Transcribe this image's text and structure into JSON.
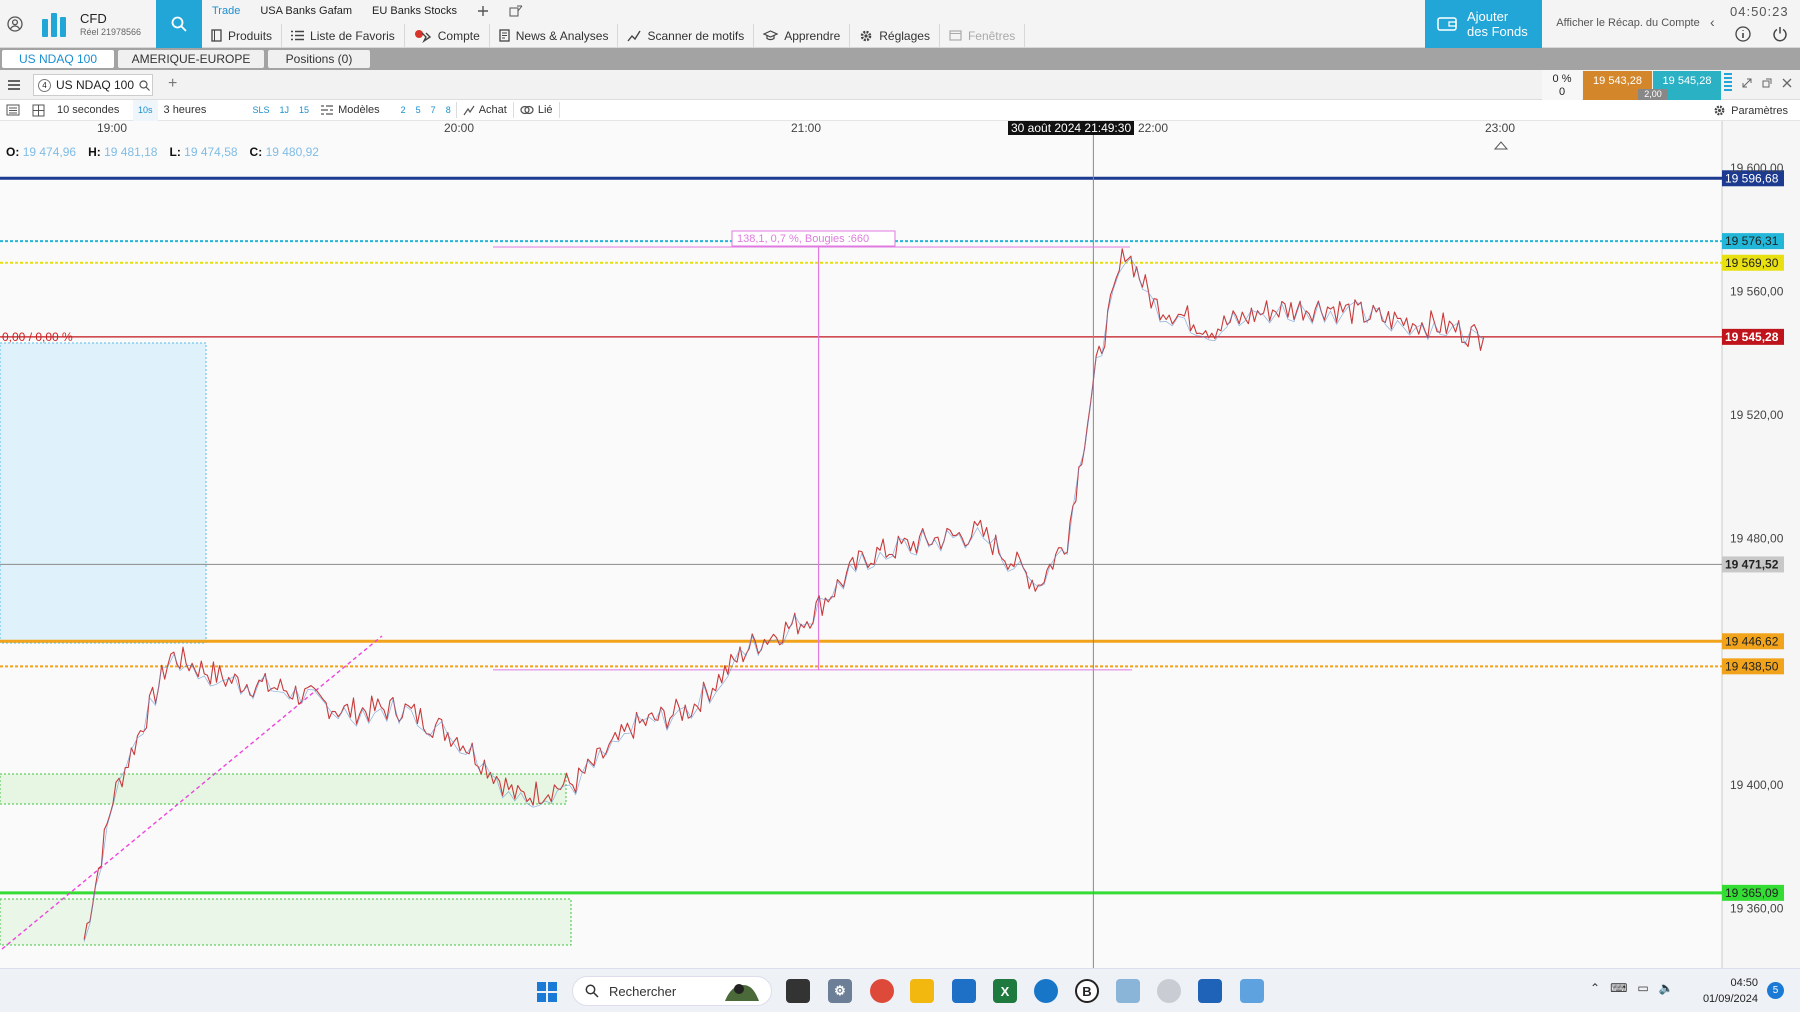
{
  "topbar": {
    "brand_title": "CFD",
    "brand_subtitle": "Réel 21978566",
    "tabs": [
      "Trade",
      "USA Banks Gafam",
      "EU Banks Stocks"
    ],
    "menu": [
      "Produits",
      "Liste de Favoris",
      "Compte",
      "News & Analyses",
      "Scanner de motifs",
      "Apprendre",
      "Réglages",
      "Fenêtres"
    ],
    "add_funds_line1": "Ajouter",
    "add_funds_line2": "des Fonds",
    "recap_link": "Afficher le Récap. du Compte",
    "clock": "04:50:23",
    "accent": "#22a6d8"
  },
  "instrument_tabs": [
    "US NDAQ 100",
    "AMERIQUE-EUROPE",
    "Positions (0)"
  ],
  "chart_header": {
    "badge": "4",
    "title": "US NDAQ 100",
    "spread_pct": "0 %",
    "spread_val": "0",
    "bid": "19 543,28",
    "ask": "19 545,28",
    "lot": "2,00"
  },
  "toolbar": {
    "interval": "10 secondes",
    "interval_short": "10s",
    "range": "3 heures",
    "sls": "SLS",
    "r1": "1J",
    "r2": "15",
    "models": "Modèles",
    "n1": "2",
    "n2": "5",
    "n3": "7",
    "n4": "8",
    "buy": "Achat",
    "linked": "Lié",
    "params": "Paramètres"
  },
  "chart": {
    "ohlc": {
      "o_label": "O:",
      "o": "19 474,96",
      "h_label": "H:",
      "h": "19 481,18",
      "l_label": "L:",
      "l": "19 474,58",
      "c_label": "C:",
      "c": "19 480,92"
    },
    "crosshair_time": "30 août 2024 21:49:30",
    "change_label": "0,00 / 0,00 %",
    "measure_label": "138,1, 0,7 %, Bougies :660"
  },
  "chart_data": {
    "type": "line",
    "title": "US NDAQ 100",
    "x": [
      "18:55",
      "19:00",
      "19:10",
      "19:20",
      "19:30",
      "19:40",
      "19:50",
      "20:00",
      "20:10",
      "20:20",
      "20:30",
      "20:40",
      "20:50",
      "21:00",
      "21:10",
      "21:20",
      "21:30",
      "21:40",
      "21:45",
      "21:50",
      "21:55",
      "22:00",
      "22:10",
      "22:20",
      "22:30",
      "22:40",
      "22:50",
      "22:57"
    ],
    "series": [
      {
        "values": [
          19350,
          19396,
          19442,
          19434,
          19431,
          19424,
          19425,
          19415,
          19396,
          19401,
          19419,
          19425,
          19445,
          19454,
          19474,
          19479,
          19482,
          19465,
          19480,
          19535,
          19574,
          19556,
          19548,
          19554,
          19555,
          19551,
          19549,
          19545
        ]
      }
    ],
    "xticks": [
      "19:00",
      "20:00",
      "21:00",
      "22:00",
      "23:00"
    ],
    "yticks": [
      "19 600,00",
      "19 560,00",
      "19 520,00",
      "19 480,00",
      "19 400,00",
      "19 360,00"
    ],
    "ylim": [
      19343,
      19612
    ],
    "price_lines": [
      {
        "label": "19 596,68",
        "value": 19596.68,
        "color": "#1c3a8f"
      },
      {
        "label": "19 576,31",
        "value": 19576.31,
        "color": "#22b6d8"
      },
      {
        "label": "19 569,30",
        "value": 19569.3,
        "color": "#e8e011"
      },
      {
        "label": "19 545,28",
        "value": 19545.28,
        "color": "#c0141c"
      },
      {
        "label": "19 471,52",
        "value": 19471.52,
        "color": "#8a8a8a"
      },
      {
        "label": "19 446,62",
        "value": 19446.62,
        "color": "#f2a31c"
      },
      {
        "label": "19 438,50",
        "value": 19438.5,
        "color": "#f2a31c"
      },
      {
        "label": "19 365,09",
        "value": 19365.09,
        "color": "#33dd33"
      }
    ]
  },
  "taskbar": {
    "search_placeholder": "Rechercher",
    "time": "04:50",
    "date": "01/09/2024",
    "notifications": "5"
  }
}
